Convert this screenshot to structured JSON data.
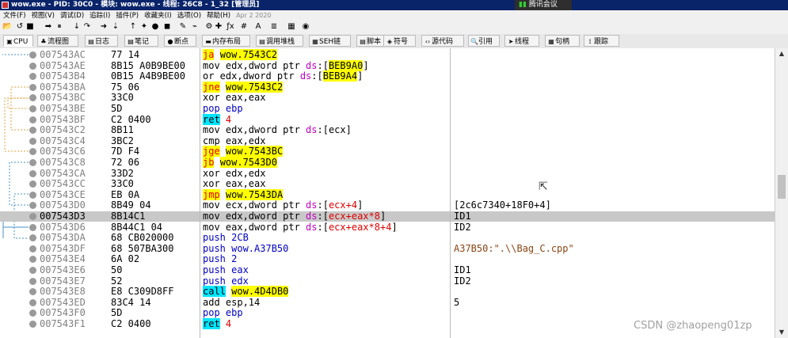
{
  "titlebar": {
    "text": "wow.exe - PID: 30C0 - 模块: wow.exe - 线程: 26C8 - 1_32 [管理员]",
    "meeting": "腾讯会议"
  },
  "menu": [
    "文件(F)",
    "视图(V)",
    "调试(D)",
    "追踪(I)",
    "插件(P)",
    "收藏夹(I)",
    "选项(O)",
    "帮助(H)"
  ],
  "date": "Apr 2 2020",
  "tabs": [
    {
      "icon": "cpu-icon",
      "glyph": "▣",
      "label": "CPU"
    },
    {
      "icon": "flowchart-icon",
      "glyph": "♣",
      "label": "流程图"
    },
    {
      "icon": "log-icon",
      "glyph": "▤",
      "label": "日志"
    },
    {
      "icon": "notes-icon",
      "glyph": "▤",
      "label": "笔记"
    },
    {
      "icon": "breakpoint-icon",
      "glyph": "●",
      "label": "断点"
    },
    {
      "icon": "memory-icon",
      "glyph": "▬",
      "label": "内存布局"
    },
    {
      "icon": "callstack-icon",
      "glyph": "▤",
      "label": "调用堆栈"
    },
    {
      "icon": "seh-icon",
      "glyph": "▦",
      "label": "SEH链"
    },
    {
      "icon": "script-icon",
      "glyph": "▤",
      "label": "脚本"
    },
    {
      "icon": "symbols-icon",
      "glyph": "◈",
      "label": "符号"
    },
    {
      "icon": "source-icon",
      "glyph": "‹›",
      "label": "源代码"
    },
    {
      "icon": "references-icon",
      "glyph": "🔍",
      "label": "引用"
    },
    {
      "icon": "threads-icon",
      "glyph": "➤",
      "label": "线程"
    },
    {
      "icon": "handles-icon",
      "glyph": "▦",
      "label": "句柄"
    },
    {
      "icon": "trace-icon",
      "glyph": "⟟",
      "label": "跟踪"
    }
  ],
  "rows": [
    {
      "addr": "007543AC",
      "bytes": "77 14",
      "instr": [
        {
          "t": "ja",
          "c": "red hl-y"
        },
        {
          "t": " "
        },
        {
          "t": "wow.7543C2",
          "c": "hl-y"
        }
      ],
      "cmt": ""
    },
    {
      "addr": "007543AE",
      "bytes": "8B15 A0B9BE00",
      "instr": [
        {
          "t": "mov edx,dword ptr "
        },
        {
          "t": "ds",
          "c": "mag"
        },
        {
          "t": ":["
        },
        {
          "t": "BEB9A0",
          "c": "hl-y"
        },
        {
          "t": "]"
        }
      ],
      "cmt": ""
    },
    {
      "addr": "007543B4",
      "bytes": "0B15 A4B9BE00",
      "instr": [
        {
          "t": "or edx,dword ptr "
        },
        {
          "t": "ds",
          "c": "mag"
        },
        {
          "t": ":["
        },
        {
          "t": "BEB9A4",
          "c": "hl-y"
        },
        {
          "t": "]"
        }
      ],
      "cmt": ""
    },
    {
      "addr": "007543BA",
      "bytes": "75 06",
      "instr": [
        {
          "t": "jne",
          "c": "red hl-y"
        },
        {
          "t": " "
        },
        {
          "t": "wow.7543C2",
          "c": "hl-y"
        }
      ],
      "cmt": ""
    },
    {
      "addr": "007543BC",
      "bytes": "33C0",
      "instr": [
        {
          "t": "xor eax,eax"
        }
      ],
      "cmt": ""
    },
    {
      "addr": "007543BE",
      "bytes": "5D",
      "instr": [
        {
          "t": "pop ebp",
          "c": "blue"
        }
      ],
      "cmt": ""
    },
    {
      "addr": "007543BF",
      "bytes": "C2 0400",
      "instr": [
        {
          "t": "ret",
          "c": "hl-c"
        },
        {
          "t": " "
        },
        {
          "t": "4",
          "c": "red"
        }
      ],
      "cmt": ""
    },
    {
      "addr": "007543C2",
      "bytes": "8B11",
      "instr": [
        {
          "t": "mov edx,dword ptr "
        },
        {
          "t": "ds",
          "c": "mag"
        },
        {
          "t": ":[ecx]"
        }
      ],
      "cmt": ""
    },
    {
      "addr": "007543C4",
      "bytes": "3BC2",
      "instr": [
        {
          "t": "cmp eax,edx"
        }
      ],
      "cmt": ""
    },
    {
      "addr": "007543C6",
      "bytes": "7D F4",
      "instr": [
        {
          "t": "jge",
          "c": "red hl-y"
        },
        {
          "t": " "
        },
        {
          "t": "wow.7543BC",
          "c": "hl-y"
        }
      ],
      "cmt": ""
    },
    {
      "addr": "007543C8",
      "bytes": "72 06",
      "instr": [
        {
          "t": "jb",
          "c": "red hl-y"
        },
        {
          "t": " "
        },
        {
          "t": "wow.7543D0",
          "c": "hl-y"
        }
      ],
      "cmt": ""
    },
    {
      "addr": "007543CA",
      "bytes": "33D2",
      "instr": [
        {
          "t": "xor edx,edx"
        }
      ],
      "cmt": ""
    },
    {
      "addr": "007543CC",
      "bytes": "33C0",
      "instr": [
        {
          "t": "xor eax,eax"
        }
      ],
      "cmt": ""
    },
    {
      "addr": "007543CE",
      "bytes": "EB 0A",
      "instr": [
        {
          "t": "jmp",
          "c": "red hl-y"
        },
        {
          "t": " "
        },
        {
          "t": "wow.7543DA",
          "c": "hl-y"
        }
      ],
      "cmt": ""
    },
    {
      "addr": "007543D0",
      "bytes": "8B49 04",
      "instr": [
        {
          "t": "mov ecx,dword ptr "
        },
        {
          "t": "ds",
          "c": "mag"
        },
        {
          "t": ":["
        },
        {
          "t": "ecx+4",
          "c": "red"
        },
        {
          "t": "]"
        }
      ],
      "cmt": "[2c6c7340+18F0+4]"
    },
    {
      "addr": "007543D3",
      "bytes": "8B14C1",
      "instr": [
        {
          "t": "mov edx,dword ptr "
        },
        {
          "t": "ds",
          "c": "mag"
        },
        {
          "t": ":["
        },
        {
          "t": "ecx+eax*8",
          "c": "red"
        },
        {
          "t": "]"
        }
      ],
      "cmt": "ID1",
      "sel": true
    },
    {
      "addr": "007543D6",
      "bytes": "8B44C1 04",
      "instr": [
        {
          "t": "mov eax,dword ptr "
        },
        {
          "t": "ds",
          "c": "mag"
        },
        {
          "t": ":["
        },
        {
          "t": "ecx+eax*8+4",
          "c": "red"
        },
        {
          "t": "]"
        }
      ],
      "cmt": "ID2"
    },
    {
      "addr": "007543DA",
      "bytes": "68 CB020000",
      "instr": [
        {
          "t": "push 2CB",
          "c": "blue"
        }
      ],
      "cmt": ""
    },
    {
      "addr": "007543DF",
      "bytes": "68 507BA300",
      "instr": [
        {
          "t": "push wow.A37B50",
          "c": "blue"
        }
      ],
      "cmt": "A37B50:\".\\\\Bag_C.cpp\"",
      "str": true
    },
    {
      "addr": "007543E4",
      "bytes": "6A 02",
      "instr": [
        {
          "t": "push 2",
          "c": "blue"
        }
      ],
      "cmt": ""
    },
    {
      "addr": "007543E6",
      "bytes": "50",
      "instr": [
        {
          "t": "push eax",
          "c": "blue"
        }
      ],
      "cmt": "ID1"
    },
    {
      "addr": "007543E7",
      "bytes": "52",
      "instr": [
        {
          "t": "push edx",
          "c": "blue"
        }
      ],
      "cmt": "ID2"
    },
    {
      "addr": "007543E8",
      "bytes": "E8 C309D8FF",
      "instr": [
        {
          "t": "call",
          "c": "hl-c"
        },
        {
          "t": " "
        },
        {
          "t": "wow.4D4DB0",
          "c": "hl-y"
        }
      ],
      "cmt": ""
    },
    {
      "addr": "007543ED",
      "bytes": "83C4 14",
      "instr": [
        {
          "t": "add esp,14"
        }
      ],
      "cmt": "5"
    },
    {
      "addr": "007543F0",
      "bytes": "5D",
      "instr": [
        {
          "t": "pop ebp",
          "c": "blue"
        }
      ],
      "cmt": ""
    },
    {
      "addr": "007543F1",
      "bytes": "C2 0400",
      "instr": [
        {
          "t": "ret",
          "c": "hl-c"
        },
        {
          "t": " "
        },
        {
          "t": "4",
          "c": "red"
        }
      ],
      "cmt": ""
    }
  ],
  "watermark": "CSDN @zhaopeng01zp"
}
